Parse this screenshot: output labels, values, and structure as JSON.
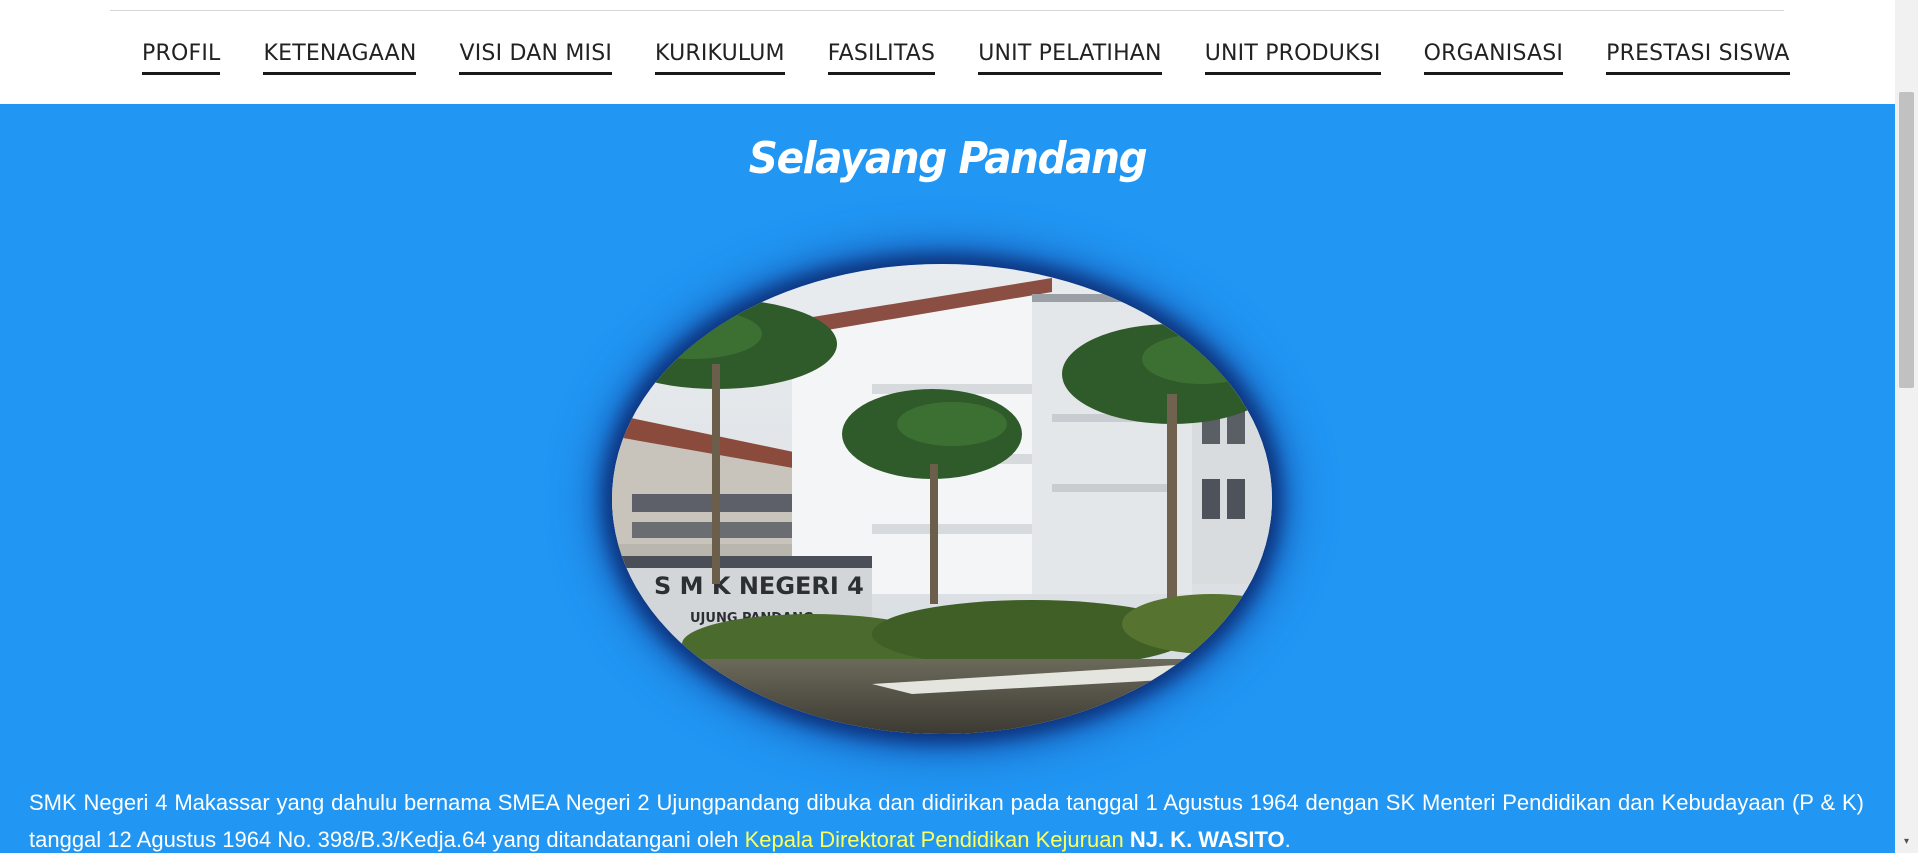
{
  "nav": {
    "items": [
      "PROFIL",
      "KETENAGAAN",
      "VISI DAN MISI",
      "KURIKULUM",
      "FASILITAS",
      "UNIT PELATIHAN",
      "UNIT PRODUKSI",
      "ORGANISASI",
      "PRESTASI SISWA"
    ]
  },
  "main": {
    "heading": "Selayang Pandang",
    "photo": {
      "sign_line1": "S M K NEGERI 4",
      "sign_line2": "UJUNG PANDANG"
    },
    "paragraph": {
      "part1": "SMK Negeri 4 Makassar yang dahulu bernama SMEA Negeri 2 Ujungpandang dibuka dan didirikan pada tanggal 1 Agustus 1964 dengan SK Menteri Pendidikan dan Kebudayaan (P & K) tanggal 12 Agustus 1964 No. 398/B.3/Kedja.64 yang ditandatangani oleh ",
      "highlight": "Kepala Direktorat Pendidikan Kejuruan",
      "space": " ",
      "name": "NJ. K. WASITO",
      "end": "."
    }
  },
  "scrollbar": {
    "down_glyph": "▾"
  },
  "colors": {
    "background_blue": "#2196f3",
    "highlight_yellow": "#ffff5a",
    "nav_text": "#222222"
  }
}
